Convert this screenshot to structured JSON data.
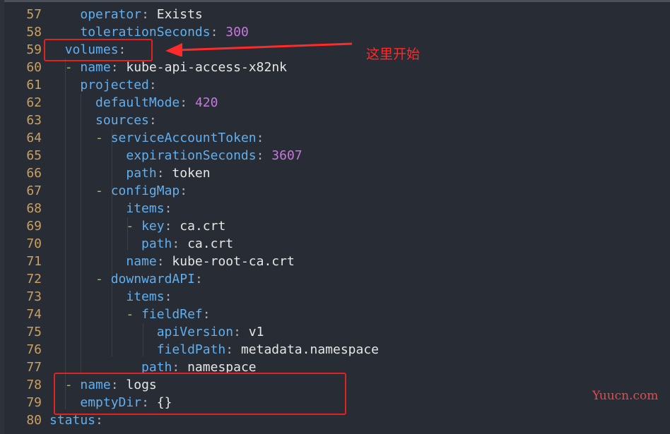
{
  "editor": {
    "lines": [
      {
        "n": "57",
        "indent": "    ",
        "dash": "",
        "key": "operator",
        "colon": ":",
        "value": "Exists",
        "vtype": "val"
      },
      {
        "n": "58",
        "indent": "    ",
        "dash": "",
        "key": "tolerationSeconds",
        "colon": ":",
        "value": "300",
        "vtype": "num"
      },
      {
        "n": "59",
        "indent": "  ",
        "dash": "",
        "key": "volumes",
        "colon": ":",
        "value": "",
        "vtype": "val"
      },
      {
        "n": "60",
        "indent": "  ",
        "dash": "- ",
        "key": "name",
        "colon": ":",
        "value": "kube-api-access-x82nk",
        "vtype": "val"
      },
      {
        "n": "61",
        "indent": "    ",
        "dash": "",
        "key": "projected",
        "colon": ":",
        "value": "",
        "vtype": "val"
      },
      {
        "n": "62",
        "indent": "      ",
        "dash": "",
        "key": "defaultMode",
        "colon": ":",
        "value": "420",
        "vtype": "num"
      },
      {
        "n": "63",
        "indent": "      ",
        "dash": "",
        "key": "sources",
        "colon": ":",
        "value": "",
        "vtype": "val"
      },
      {
        "n": "64",
        "indent": "      ",
        "dash": "- ",
        "key": "serviceAccountToken",
        "colon": ":",
        "value": "",
        "vtype": "val"
      },
      {
        "n": "65",
        "indent": "          ",
        "dash": "",
        "key": "expirationSeconds",
        "colon": ":",
        "value": "3607",
        "vtype": "num"
      },
      {
        "n": "66",
        "indent": "          ",
        "dash": "",
        "key": "path",
        "colon": ":",
        "value": "token",
        "vtype": "val"
      },
      {
        "n": "67",
        "indent": "      ",
        "dash": "- ",
        "key": "configMap",
        "colon": ":",
        "value": "",
        "vtype": "val"
      },
      {
        "n": "68",
        "indent": "          ",
        "dash": "",
        "key": "items",
        "colon": ":",
        "value": "",
        "vtype": "val"
      },
      {
        "n": "69",
        "indent": "          ",
        "dash": "- ",
        "key": "key",
        "colon": ":",
        "value": "ca.crt",
        "vtype": "val"
      },
      {
        "n": "70",
        "indent": "            ",
        "dash": "",
        "key": "path",
        "colon": ":",
        "value": "ca.crt",
        "vtype": "val"
      },
      {
        "n": "71",
        "indent": "          ",
        "dash": "",
        "key": "name",
        "colon": ":",
        "value": "kube-root-ca.crt",
        "vtype": "val"
      },
      {
        "n": "72",
        "indent": "      ",
        "dash": "- ",
        "key": "downwardAPI",
        "colon": ":",
        "value": "",
        "vtype": "val"
      },
      {
        "n": "73",
        "indent": "          ",
        "dash": "",
        "key": "items",
        "colon": ":",
        "value": "",
        "vtype": "val"
      },
      {
        "n": "74",
        "indent": "          ",
        "dash": "- ",
        "key": "fieldRef",
        "colon": ":",
        "value": "",
        "vtype": "val"
      },
      {
        "n": "75",
        "indent": "              ",
        "dash": "",
        "key": "apiVersion",
        "colon": ":",
        "value": "v1",
        "vtype": "val"
      },
      {
        "n": "76",
        "indent": "              ",
        "dash": "",
        "key": "fieldPath",
        "colon": ":",
        "value": "metadata.namespace",
        "vtype": "val"
      },
      {
        "n": "77",
        "indent": "            ",
        "dash": "",
        "key": "path",
        "colon": ":",
        "value": "namespace",
        "vtype": "val"
      },
      {
        "n": "78",
        "indent": "  ",
        "dash": "- ",
        "key": "name",
        "colon": ":",
        "value": "logs",
        "vtype": "val"
      },
      {
        "n": "79",
        "indent": "    ",
        "dash": "",
        "key": "emptyDir",
        "colon": ":",
        "value": "{}",
        "vtype": "val"
      },
      {
        "n": "80",
        "indent": "",
        "dash": "",
        "key": "status",
        "colon": ":",
        "value": "",
        "vtype": "val"
      }
    ]
  },
  "annotation": {
    "text": "这里开始",
    "color": "#ff2a2a"
  },
  "watermark": {
    "text": "Yuucn.com"
  },
  "colors": {
    "background": "#282c34",
    "line_number": "#c8a063",
    "key": "#61afef",
    "number": "#c678dd",
    "value": "#e6e6e6",
    "highlight_box": "#e02222"
  }
}
